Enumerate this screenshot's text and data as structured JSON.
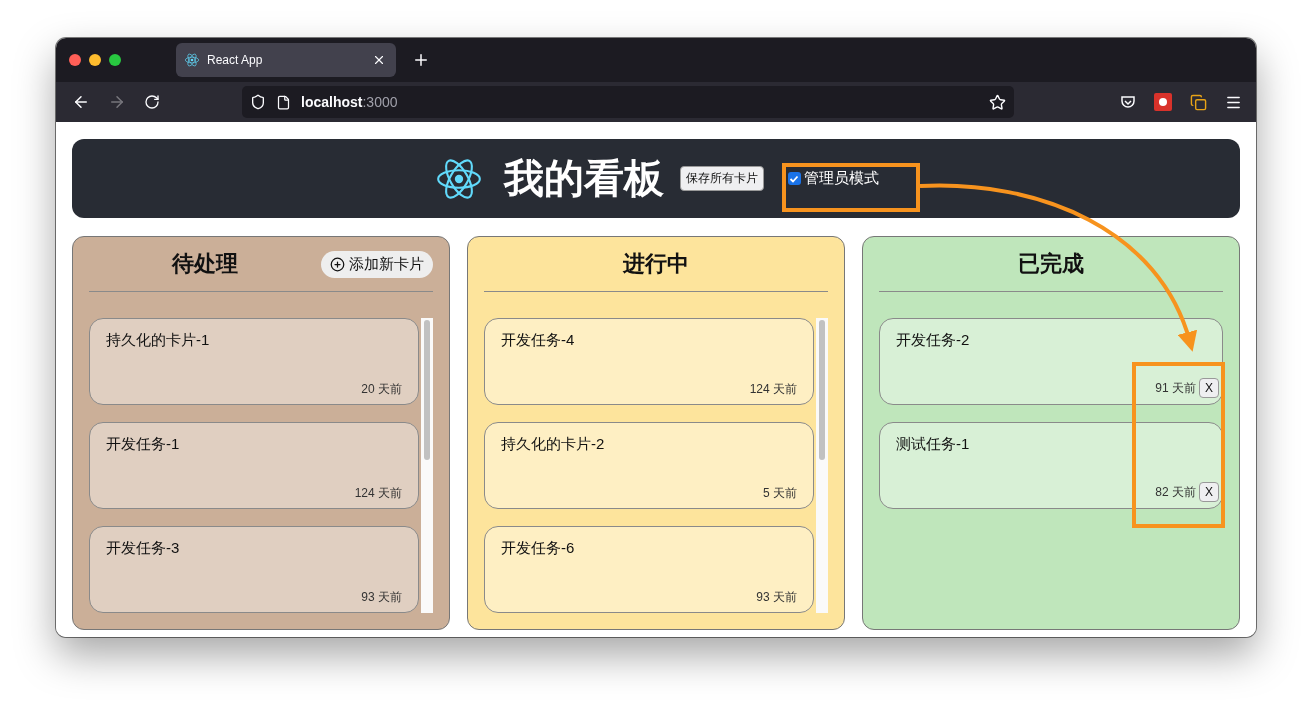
{
  "browser": {
    "tab_title": "React App",
    "url_host": "localhost",
    "url_port": ":3000"
  },
  "header": {
    "title": "我的看板",
    "save_button": "保存所有卡片",
    "admin_mode": {
      "label": "管理员模式",
      "checked": true
    }
  },
  "columns": [
    {
      "title": "待处理",
      "color": "#cbaf98",
      "add_button": "添加新卡片",
      "scrollable": true,
      "cards": [
        {
          "title": "持久化的卡片-1",
          "age": "20 天前"
        },
        {
          "title": "开发任务-1",
          "age": "124 天前"
        },
        {
          "title": "开发任务-3",
          "age": "93 天前"
        }
      ]
    },
    {
      "title": "进行中",
      "color": "#fde49c",
      "scrollable": true,
      "cards": [
        {
          "title": "开发任务-4",
          "age": "124 天前"
        },
        {
          "title": "持久化的卡片-2",
          "age": "5 天前"
        },
        {
          "title": "开发任务-6",
          "age": "93 天前"
        }
      ]
    },
    {
      "title": "已完成",
      "color": "#bfe6bb",
      "scrollable": false,
      "cards": [
        {
          "title": "开发任务-2",
          "age": "91 天前",
          "delete_button": "X"
        },
        {
          "title": "测试任务-1",
          "age": "82 天前",
          "delete_button": "X"
        }
      ]
    }
  ]
}
